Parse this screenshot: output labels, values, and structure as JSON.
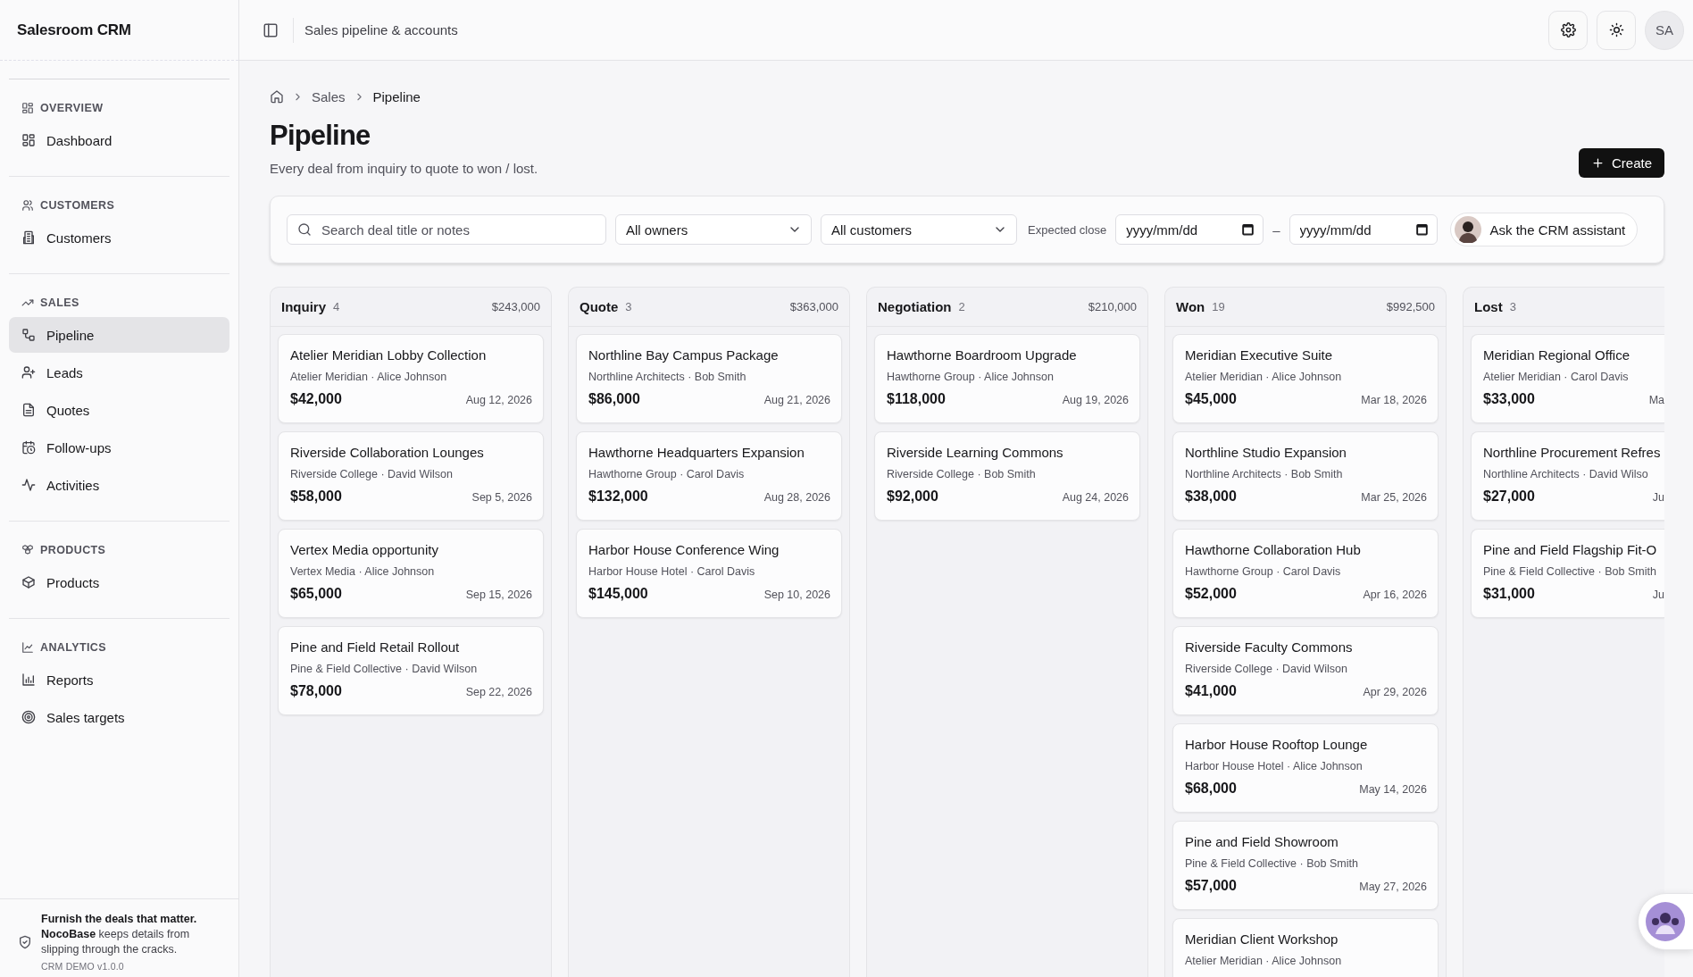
{
  "sidebar": {
    "brand": "Salesroom CRM",
    "sections": [
      {
        "title": "OVERVIEW",
        "items": [
          {
            "label": "Dashboard",
            "selected": false
          }
        ]
      },
      {
        "title": "CUSTOMERS",
        "items": [
          {
            "label": "Customers",
            "selected": false
          }
        ]
      },
      {
        "title": "SALES",
        "items": [
          {
            "label": "Pipeline",
            "selected": true
          },
          {
            "label": "Leads",
            "selected": false
          },
          {
            "label": "Quotes",
            "selected": false
          },
          {
            "label": "Follow-ups",
            "selected": false
          },
          {
            "label": "Activities",
            "selected": false
          }
        ]
      },
      {
        "title": "PRODUCTS",
        "items": [
          {
            "label": "Products",
            "selected": false
          }
        ]
      },
      {
        "title": "ANALYTICS",
        "items": [
          {
            "label": "Reports",
            "selected": false
          },
          {
            "label": "Sales targets",
            "selected": false
          }
        ]
      }
    ],
    "footer": {
      "text": "**Furnish the deals that matter.** **NocoBase** keeps details from slipping through the cracks.",
      "version": "CRM DEMO v1.0.0"
    }
  },
  "header": {
    "title": "Sales pipeline & accounts",
    "avatar": "SA"
  },
  "breadcrumb": [
    "Sales",
    "Pipeline"
  ],
  "page": {
    "title": "Pipeline",
    "subtitle": "Every deal from inquiry to quote to won / lost.",
    "create_button": "Create"
  },
  "filters": {
    "search": {
      "placeholder": "Search deal title or notes"
    },
    "owner": "All owners",
    "customer": "All customers",
    "close_label": "Expected close",
    "date_from": {
      "placeholder": "yyyy/mm/dd"
    },
    "separator": "–",
    "date_to": {
      "placeholder": "yyyy/mm/dd"
    },
    "assistant_button": "Ask the CRM assistant"
  },
  "columns": [
    {
      "name": "Inquiry",
      "count": "4",
      "total": "$243,000",
      "cards": [
        {
          "title": "Atelier Meridian Lobby Collection",
          "meta": "Atelier Meridian · Alice Johnson",
          "amount": "$42,000",
          "date": "Aug 12, 2026"
        },
        {
          "title": "Riverside Collaboration Lounges",
          "meta": "Riverside College · David Wilson",
          "amount": "$58,000",
          "date": "Sep 5, 2026"
        },
        {
          "title": "Vertex Media opportunity",
          "meta": "Vertex Media · Alice Johnson",
          "amount": "$65,000",
          "date": "Sep 15, 2026"
        },
        {
          "title": "Pine and Field Retail Rollout",
          "meta": "Pine & Field Collective · David Wilson",
          "amount": "$78,000",
          "date": "Sep 22, 2026"
        }
      ]
    },
    {
      "name": "Quote",
      "count": "3",
      "total": "$363,000",
      "cards": [
        {
          "title": "Northline Bay Campus Package",
          "meta": "Northline Architects · Bob Smith",
          "amount": "$86,000",
          "date": "Aug 21, 2026"
        },
        {
          "title": "Hawthorne Headquarters Expansion",
          "meta": "Hawthorne Group · Carol Davis",
          "amount": "$132,000",
          "date": "Aug 28, 2026"
        },
        {
          "title": "Harbor House Conference Wing",
          "meta": "Harbor House Hotel · Carol Davis",
          "amount": "$145,000",
          "date": "Sep 10, 2026"
        }
      ]
    },
    {
      "name": "Negotiation",
      "count": "2",
      "total": "$210,000",
      "cards": [
        {
          "title": "Hawthorne Boardroom Upgrade",
          "meta": "Hawthorne Group · Alice Johnson",
          "amount": "$118,000",
          "date": "Aug 19, 2026"
        },
        {
          "title": "Riverside Learning Commons",
          "meta": "Riverside College · Bob Smith",
          "amount": "$92,000",
          "date": "Aug 24, 2026"
        }
      ]
    },
    {
      "name": "Won",
      "count": "19",
      "total": "$992,500",
      "cards": [
        {
          "title": "Meridian Executive Suite",
          "meta": "Atelier Meridian · Alice Johnson",
          "amount": "$45,000",
          "date": "Mar 18, 2026"
        },
        {
          "title": "Northline Studio Expansion",
          "meta": "Northline Architects · Bob Smith",
          "amount": "$38,000",
          "date": "Mar 25, 2026"
        },
        {
          "title": "Hawthorne Collaboration Hub",
          "meta": "Hawthorne Group · Carol Davis",
          "amount": "$52,000",
          "date": "Apr 16, 2026"
        },
        {
          "title": "Riverside Faculty Commons",
          "meta": "Riverside College · David Wilson",
          "amount": "$41,000",
          "date": "Apr 29, 2026"
        },
        {
          "title": "Harbor House Rooftop Lounge",
          "meta": "Harbor House Hotel · Alice Johnson",
          "amount": "$68,000",
          "date": "May 14, 2026"
        },
        {
          "title": "Pine and Field Showroom",
          "meta": "Pine & Field Collective · Bob Smith",
          "amount": "$57,000",
          "date": "May 27, 2026"
        },
        {
          "title": "Meridian Client Workshop",
          "meta": "Atelier Meridian · Alice Johnson"
        }
      ]
    },
    {
      "name": "Lost",
      "count": "3",
      "cards": [
        {
          "title": "Meridian Regional Office",
          "meta": "Atelier Meridian · Carol Davis",
          "amount": "$33,000",
          "date": "Ma"
        },
        {
          "title": "Northline Procurement Refres",
          "meta": "Northline Architects · David Wilso",
          "amount": "$27,000",
          "date": "Ju"
        },
        {
          "title": "Pine and Field Flagship Fit-O",
          "meta": "Pine & Field Collective · Bob Smith",
          "amount": "$31,000",
          "date": "Ju"
        }
      ]
    }
  ]
}
